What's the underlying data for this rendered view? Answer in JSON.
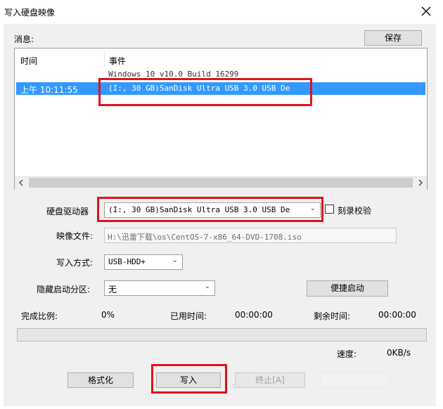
{
  "window": {
    "title": "写入硬盘映像",
    "close_icon": "close-icon"
  },
  "messages": {
    "label": "消息:",
    "save_button": "保存",
    "columns": [
      "时间",
      "事件"
    ],
    "rows": [
      {
        "time": "",
        "event": "Windows 10 v10.0 Build 16299"
      },
      {
        "time": "上午 10:11:55",
        "event": "(I:, 30 GB)SanDisk Ultra USB 3.0 USB De"
      }
    ]
  },
  "form": {
    "drive_label": "硬盘驱动器",
    "drive_value": "(I:, 30 GB)SanDisk Ultra USB 3.0 USB De",
    "verify_label": "刻录校验",
    "image_label": "映像文件:",
    "image_value": "H:\\迅雷下载\\os\\CentOS-7-x86_64-DVD-1708.iso",
    "method_label": "写入方式:",
    "method_value": "USB-HDD+",
    "hidden_label": "隐藏启动分区:",
    "hidden_value": "无",
    "quick_boot_button": "便捷启动"
  },
  "progress": {
    "done_label": "完成比例:",
    "done_value": "0%",
    "elapsed_label": "已用时间:",
    "elapsed_value": "00:00:00",
    "remaining_label": "剩余时间:",
    "remaining_value": "00:00:00",
    "fraction": 0,
    "speed_label": "速度:",
    "speed_value": "0KB/s"
  },
  "buttons": {
    "format": "格式化",
    "write": "写入",
    "stop": "终止[A]"
  },
  "colors": {
    "highlight": "#3399ff",
    "annotation_red": "#e0131c"
  }
}
